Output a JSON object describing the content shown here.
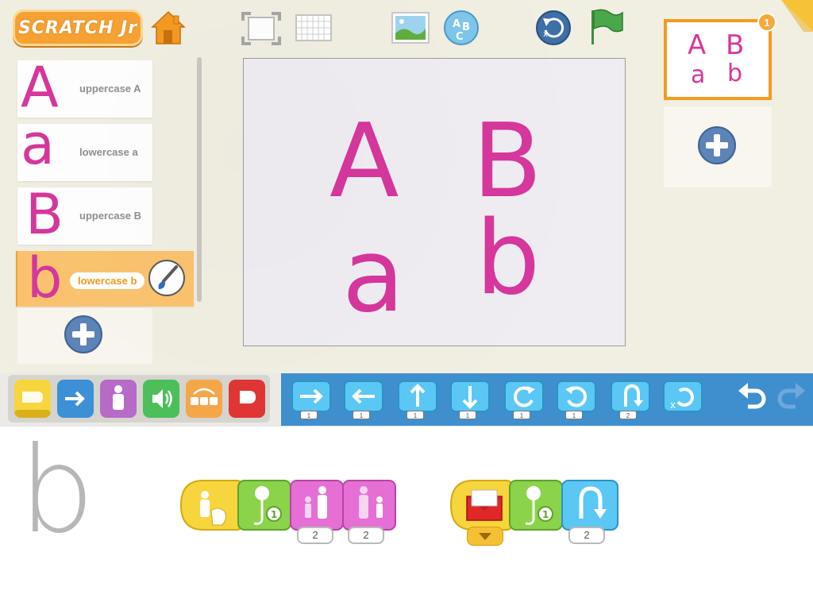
{
  "app": {
    "logo_text": "SCRATCH Jr"
  },
  "toolbar": {
    "icons": [
      "home-icon",
      "presentation-mode-icon",
      "grid-icon",
      "background-icon",
      "text-icon",
      "reset-characters-icon",
      "green-flag-icon"
    ]
  },
  "characters": {
    "items": [
      {
        "glyph": "A",
        "label": "uppercase A",
        "selected": false
      },
      {
        "glyph": "a",
        "label": "lowercase a",
        "selected": false
      },
      {
        "glyph": "B",
        "label": "uppercase B",
        "selected": false
      },
      {
        "glyph": "b",
        "label": "lowercase b",
        "selected": true
      }
    ]
  },
  "stage": {
    "letters": [
      "A",
      "B",
      "a",
      "b"
    ]
  },
  "pages": {
    "badge": "1",
    "thumb_letters": [
      "A",
      "B",
      "a",
      "b"
    ]
  },
  "palette": {
    "categories": [
      "triggering-blocks",
      "motion-blocks",
      "looks-blocks",
      "sound-blocks",
      "control-blocks",
      "end-blocks"
    ],
    "motion_blocks": [
      {
        "name": "move-right",
        "count": "1"
      },
      {
        "name": "move-left",
        "count": "1"
      },
      {
        "name": "move-up",
        "count": "1"
      },
      {
        "name": "move-down",
        "count": "1"
      },
      {
        "name": "turn-right",
        "count": "1"
      },
      {
        "name": "turn-left",
        "count": "1"
      },
      {
        "name": "hop",
        "count": "2"
      },
      {
        "name": "go-home",
        "count": ""
      }
    ]
  },
  "script": {
    "sprite_letter": "b",
    "script1": {
      "counts": [
        "2",
        "2"
      ]
    },
    "script2": {
      "counts": [
        "2"
      ]
    }
  },
  "colors": {
    "letter_pink": "#d6379c",
    "selected_orange": "#f39c1f",
    "motion_blue": "#3f8fcf",
    "paper": "#f1eee2"
  }
}
